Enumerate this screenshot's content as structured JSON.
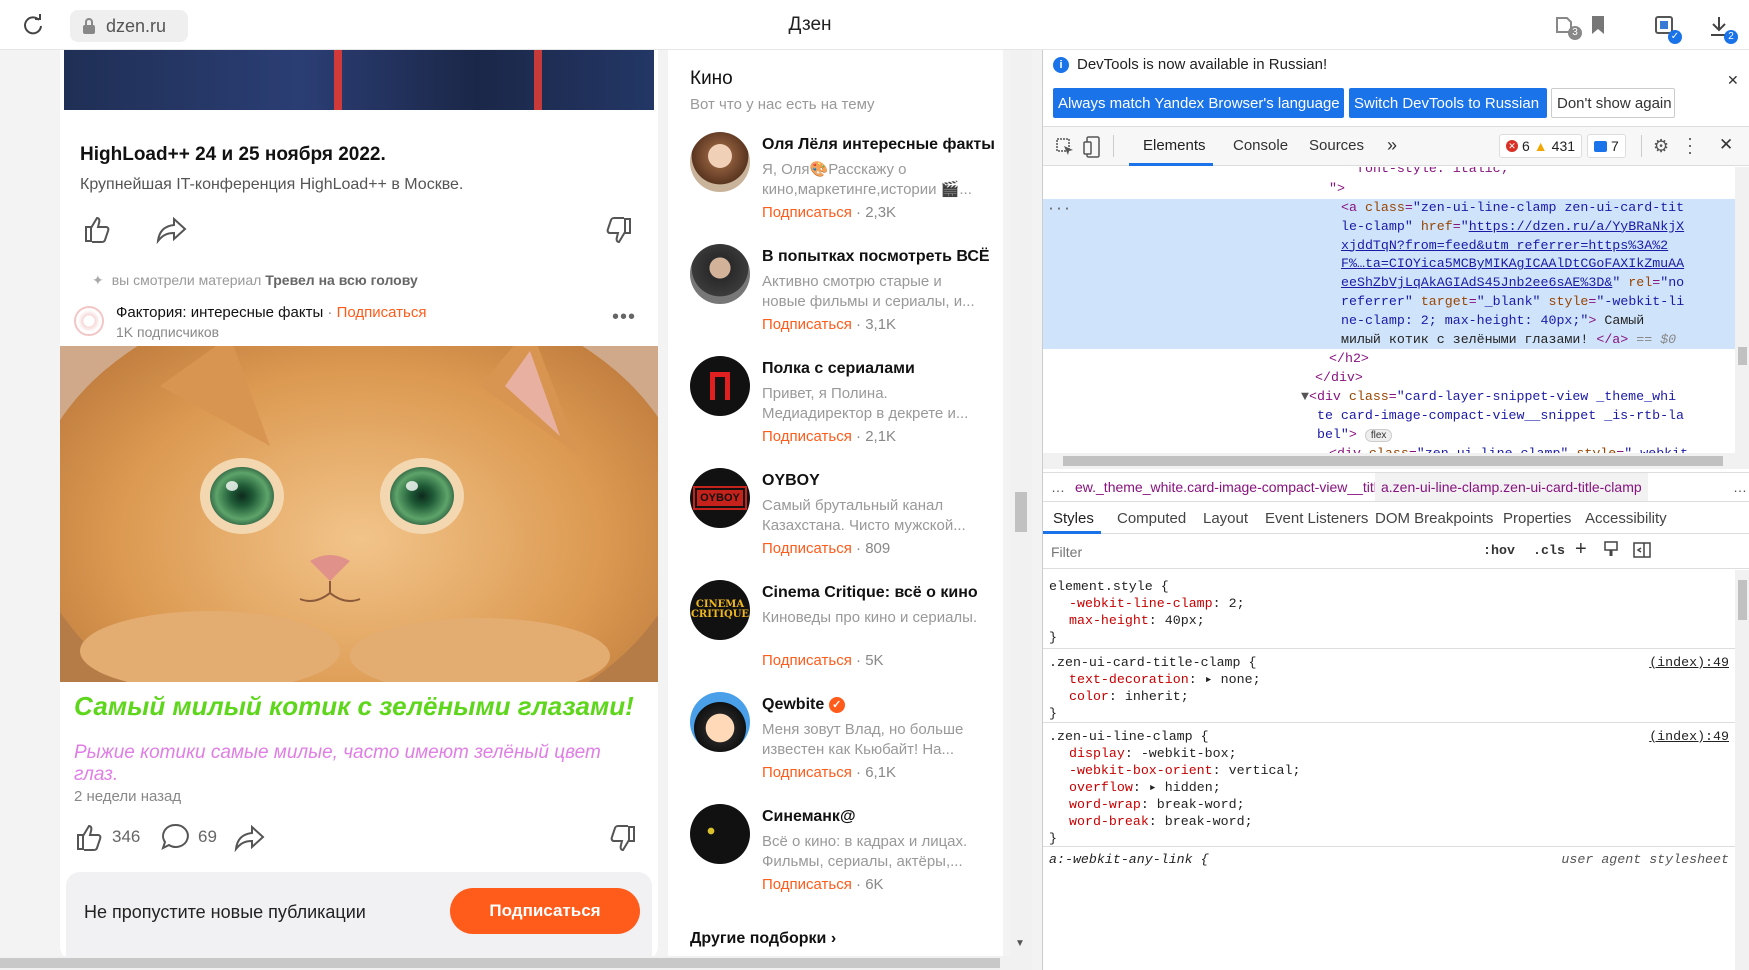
{
  "browser": {
    "url": "dzen.ru",
    "title": "Дзен",
    "ext_badge": "3",
    "download_badge": "2"
  },
  "card1": {
    "title": "HighLoad++ 24 и 25 ноября 2022.",
    "subtitle": "Крупнейшая IT-конференция HighLoad++ в Москве."
  },
  "card2": {
    "seen_prefix": "вы смотрели материал",
    "seen_title": "Тревел на всю голову",
    "channel": "Фактория: интересные факты",
    "dot": "·",
    "subscribe": "Подписаться",
    "subs_count": "1K подписчиков",
    "title": "Самый милый котик с зелёными глазами!",
    "desc": "Рыжие котики самые милые, часто имеют зелёный цвет глаз.",
    "time": "2 недели назад",
    "likes": "346",
    "comments": "69"
  },
  "banner": {
    "text": "Не пропустите новые публикации",
    "button": "Подписаться"
  },
  "sidebar": {
    "title": "Кино",
    "subtitle": "Вот что у нас есть на тему",
    "more": "Другие подборки",
    "items": [
      {
        "name": "Оля Лёля интересные факты",
        "desc": "Я, Оля🎨Расскажу о кино,маркетинге,истории 🎬...",
        "sub": "Подписаться",
        "count": "· 2,3K"
      },
      {
        "name": "В попытках посмотреть ВСЁ",
        "desc": "Активно смотрю старые и новые фильмы и сериалы, и...",
        "sub": "Подписаться",
        "count": "· 3,1K"
      },
      {
        "name": "Полка с сериалами",
        "desc": "Привет, я Полина. Медиадиректор в декрете и...",
        "sub": "Подписаться",
        "count": "· 2,1K"
      },
      {
        "name": "OYBOY",
        "desc": "Самый брутальный канал Казахстана. Чисто мужской...",
        "sub": "Подписаться",
        "count": "· 809"
      },
      {
        "name": "Cinema Critique: всё о кино",
        "desc": "Киноведы про кино и сериалы.",
        "sub": "Подписаться",
        "count": "· 5K"
      },
      {
        "name": "Qewbite",
        "desc": "Меня зовут Влад, но больше известен как Кьюбайт! На...",
        "sub": "Подписаться",
        "count": "· 6,1K"
      },
      {
        "name": "Синеманк@",
        "desc": "Всё о кино: в кадрах и лицах. Фильмы, сериалы, актёры,...",
        "sub": "Подписаться",
        "count": "· 6K"
      }
    ]
  },
  "devtools": {
    "notice": "DevTools is now available in Russian!",
    "btn_match": "Always match Yandex Browser's language",
    "btn_switch": "Switch DevTools to Russian",
    "btn_dont": "Don't show again",
    "tabs": [
      "Elements",
      "Console",
      "Sources"
    ],
    "errors": "6",
    "warnings": "431",
    "messages": "7",
    "breadcrumb1": "ew._theme_white.card-image-compact-view__title",
    "breadcrumb2": "a.zen-ui-line-clamp.zen-ui-card-title-clamp",
    "style_tabs": [
      "Styles",
      "Computed",
      "Layout",
      "Event Listeners",
      "DOM Breakpoints",
      "Properties",
      "Accessibility"
    ],
    "filter_placeholder": "Filter",
    "hov": ":hov",
    "cls": ".cls",
    "flex_badge": "flex",
    "rules": {
      "r1_sel": "element.style {",
      "r1_p1": "-webkit-line-clamp",
      "r1_v1": "2",
      "r1_p2": "max-height",
      "r1_v2": "40px",
      "r2_sel": ".zen-ui-card-title-clamp {",
      "r2_src": "(index):49",
      "r2_p1": "text-decoration",
      "r2_v1": "none",
      "r2_p2": "color",
      "r2_v2": "inherit",
      "r3_sel": ".zen-ui-line-clamp {",
      "r3_src": "(index):49",
      "r3_p1": "display",
      "r3_v1": "-webkit-box",
      "r3_p2": "-webkit-box-orient",
      "r3_v2": "vertical",
      "r3_p3": "overflow",
      "r3_v3": "hidden",
      "r3_p4": "word-wrap",
      "r3_v4": "break-word",
      "r3_p5": "word-break",
      "r3_v5": "break-word",
      "r4_sel": "a:-webkit-any-link {",
      "r4_src": "user agent stylesheet"
    }
  },
  "colors": {
    "accent": "#ff5b1a",
    "title_green": "#5ed61c",
    "desc_pink": "#e07ee6",
    "devtools_blue": "#1a73e8"
  }
}
